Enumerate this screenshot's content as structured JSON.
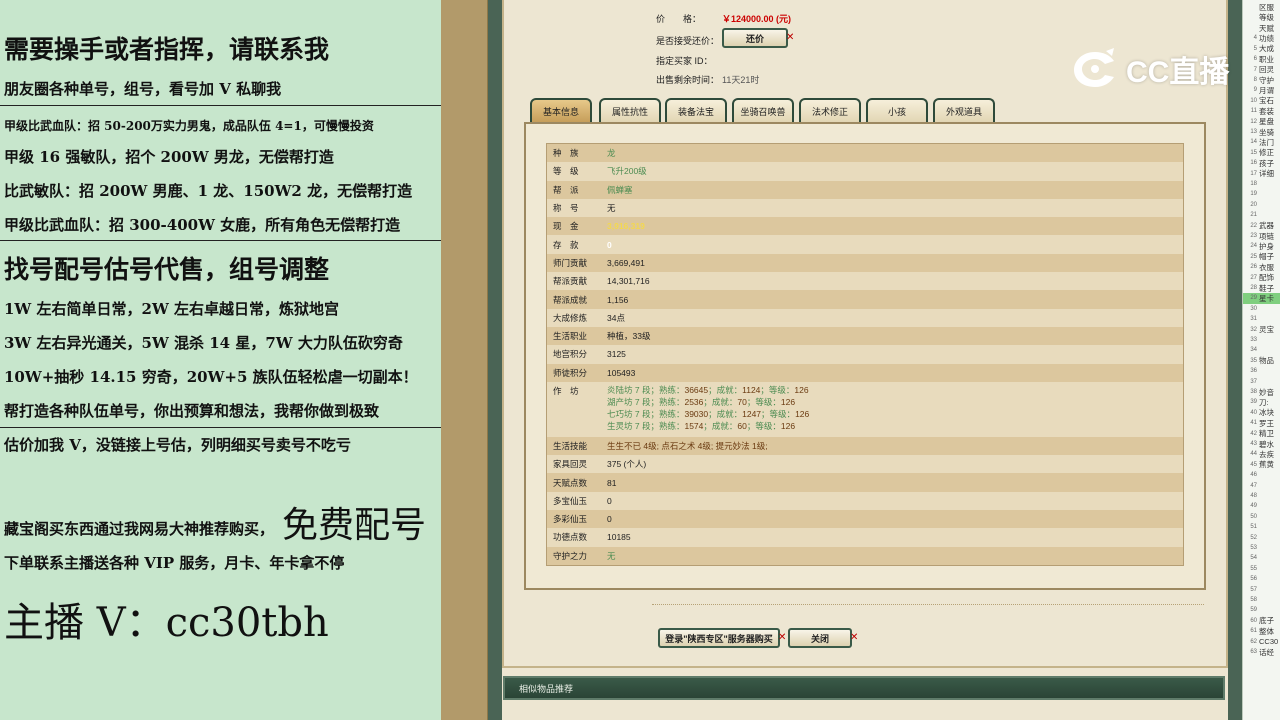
{
  "promo": {
    "line1": "需要操手或者指挥，请联系我",
    "line2": "朋友圈各种单号，组号，看号加 V 私聊我",
    "line3": "甲级比武血队：招 50-200万实力男鬼，成品队伍 4=1，可慢慢投资",
    "line4": "甲级 16 强敏队，招个 200W 男龙，无偿帮打造",
    "line5": "比武敏队：招 200W 男鹿、1 龙、150W2 龙，无偿帮打造",
    "line6": "甲级比武血队：招 300-400W 女鹿，所有角色无偿帮打造",
    "line7": "找号配号估号代售，组号调整",
    "line8": "1W 左右简单日常，2W 左右卓越日常，炼狱地宫",
    "line9": "3W 左右异光通关，5W 混杀 14 星，7W 大力队伍砍穷奇",
    "line10": "10W+抽秒 14.15 穷奇，20W+5 族队伍轻松虐一切副本！",
    "line11": "帮打造各种队伍单号，你出预算和想法，我帮你做到极致",
    "line12": "估价加我 V，没链接上号估，列明细买号卖号不吃亏",
    "line13": "藏宝阁买东西通过我网易大神推荐购买，",
    "line13_big": "免费配号",
    "line14": "下单联系主播送各种 VIP 服务，月卡、年卡拿不停",
    "line15": "主播 V：cc30tbh"
  },
  "listing": {
    "price_label": "价　　格：",
    "price_value": "￥124000.00 (元)",
    "counter_offer_label": "是否接受还价：",
    "counter_offer_button": "还价",
    "buyer_id_label": "指定买家 ID：",
    "time_label": "出售剩余时间：",
    "time_value": "11天21时"
  },
  "tabs": [
    "基本信息",
    "属性抗性",
    "装备法宝",
    "坐骑召唤兽",
    "法术修正",
    "小孩",
    "外观道具"
  ],
  "attributes": [
    {
      "k": "种　族",
      "v": "龙",
      "c": "green"
    },
    {
      "k": "等　级",
      "v": "飞升200级",
      "c": "green"
    },
    {
      "k": "帮　派",
      "v": "佩蝉塞",
      "c": "green"
    },
    {
      "k": "称　号",
      "v": "无",
      "c": ""
    },
    {
      "k": "现　金",
      "v": "3,916,319",
      "c": "yellow"
    },
    {
      "k": "存　款",
      "v": "0",
      "c": "white"
    },
    {
      "k": "师门贡献",
      "v": "3,669,491",
      "c": ""
    },
    {
      "k": "帮派贡献",
      "v": "14,301,716",
      "c": ""
    },
    {
      "k": "帮派成就",
      "v": "1,156",
      "c": ""
    },
    {
      "k": "大成修炼",
      "v": "34点",
      "c": ""
    },
    {
      "k": "生活职业",
      "v": "种植，33级",
      "c": ""
    },
    {
      "k": "地宫积分",
      "v": "3125",
      "c": ""
    },
    {
      "k": "师徒积分",
      "v": "105493",
      "c": ""
    }
  ],
  "workshop": {
    "label": "作　坊",
    "lines": [
      {
        "name": "炎陆坊 7 段；",
        "skill": "熟练：",
        "skill_v": "36645",
        "ach": "；成就：",
        "ach_v": "1124",
        "lv": "；等级：",
        "lv_v": "126"
      },
      {
        "name": "湖产坊 7 段；",
        "skill": "熟练：",
        "skill_v": "2536",
        "ach": "；成就：",
        "ach_v": "70",
        "lv": "；等级：",
        "lv_v": "126"
      },
      {
        "name": "七巧坊 7 段；",
        "skill": "熟练：",
        "skill_v": "39030",
        "ach": "；成就：",
        "ach_v": "1247",
        "lv": "；等级：",
        "lv_v": "126"
      },
      {
        "name": "生灵坊 7 段；",
        "skill": "熟练：",
        "skill_v": "1574",
        "ach": "；成就：",
        "ach_v": "60",
        "lv": "；等级：",
        "lv_v": "126"
      }
    ]
  },
  "attributes2": [
    {
      "k": "生活技能",
      "v": "生生不已 4级; 点石之术 4级; 提元妙法 1级;",
      "c": ""
    },
    {
      "k": "家具回灵",
      "v": "375 (个人)",
      "c": ""
    },
    {
      "k": "天赋点数",
      "v": "81",
      "c": ""
    },
    {
      "k": "多宝仙玉",
      "v": "0",
      "c": ""
    },
    {
      "k": "多彩仙玉",
      "v": "0",
      "c": ""
    },
    {
      "k": "功德点数",
      "v": "10185",
      "c": ""
    },
    {
      "k": "守护之力",
      "v": "无",
      "c": "green"
    }
  ],
  "buttons": {
    "buy": "登录\"陕西专区\"服务器购买",
    "close": "关闭"
  },
  "recommend_title": "相似物品推荐",
  "logo": {
    "text": "CC直播",
    "icon": "cc-live-logo-icon"
  },
  "sidebar": [
    {
      "n": "",
      "t": "区服"
    },
    {
      "n": "",
      "t": "等级"
    },
    {
      "n": "",
      "t": "天赋"
    },
    {
      "n": "4",
      "t": "功绩"
    },
    {
      "n": "5",
      "t": "大成"
    },
    {
      "n": "6",
      "t": "职业"
    },
    {
      "n": "7",
      "t": "回灵"
    },
    {
      "n": "8",
      "t": "守护"
    },
    {
      "n": "9",
      "t": "月谓"
    },
    {
      "n": "10",
      "t": "宝石"
    },
    {
      "n": "11",
      "t": "套装"
    },
    {
      "n": "12",
      "t": "星盘"
    },
    {
      "n": "13",
      "t": "坐骑"
    },
    {
      "n": "14",
      "t": "法门"
    },
    {
      "n": "15",
      "t": "修正"
    },
    {
      "n": "16",
      "t": "孩子"
    },
    {
      "n": "17",
      "t": "详细"
    },
    {
      "n": "18",
      "t": ""
    },
    {
      "n": "19",
      "t": ""
    },
    {
      "n": "20",
      "t": ""
    },
    {
      "n": "21",
      "t": ""
    },
    {
      "n": "22",
      "t": "武器"
    },
    {
      "n": "23",
      "t": "项链"
    },
    {
      "n": "24",
      "t": "护身"
    },
    {
      "n": "25",
      "t": "帽子"
    },
    {
      "n": "26",
      "t": "衣服"
    },
    {
      "n": "27",
      "t": "配饰"
    },
    {
      "n": "28",
      "t": "鞋子"
    },
    {
      "n": "29",
      "t": "星卡",
      "hl": true
    },
    {
      "n": "30",
      "t": ""
    },
    {
      "n": "31",
      "t": ""
    },
    {
      "n": "32",
      "t": "灵宝"
    },
    {
      "n": "33",
      "t": ""
    },
    {
      "n": "34",
      "t": ""
    },
    {
      "n": "35",
      "t": "物品"
    },
    {
      "n": "36",
      "t": ""
    },
    {
      "n": "37",
      "t": ""
    },
    {
      "n": "38",
      "t": "妙音"
    },
    {
      "n": "39",
      "t": "刀:"
    },
    {
      "n": "40",
      "t": "冰块"
    },
    {
      "n": "41",
      "t": "罗王"
    },
    {
      "n": "42",
      "t": "精卫"
    },
    {
      "n": "43",
      "t": "碧水"
    },
    {
      "n": "44",
      "t": "去疾"
    },
    {
      "n": "45",
      "t": "蕉黄"
    },
    {
      "n": "46",
      "t": ""
    },
    {
      "n": "47",
      "t": ""
    },
    {
      "n": "48",
      "t": ""
    },
    {
      "n": "49",
      "t": ""
    },
    {
      "n": "50",
      "t": ""
    },
    {
      "n": "51",
      "t": ""
    },
    {
      "n": "52",
      "t": ""
    },
    {
      "n": "53",
      "t": ""
    },
    {
      "n": "54",
      "t": ""
    },
    {
      "n": "55",
      "t": ""
    },
    {
      "n": "56",
      "t": ""
    },
    {
      "n": "57",
      "t": ""
    },
    {
      "n": "58",
      "t": ""
    },
    {
      "n": "59",
      "t": ""
    },
    {
      "n": "60",
      "t": "底子"
    },
    {
      "n": "61",
      "t": "整体"
    },
    {
      "n": "62",
      "t": "CC30"
    },
    {
      "n": "63",
      "t": "话经"
    }
  ]
}
